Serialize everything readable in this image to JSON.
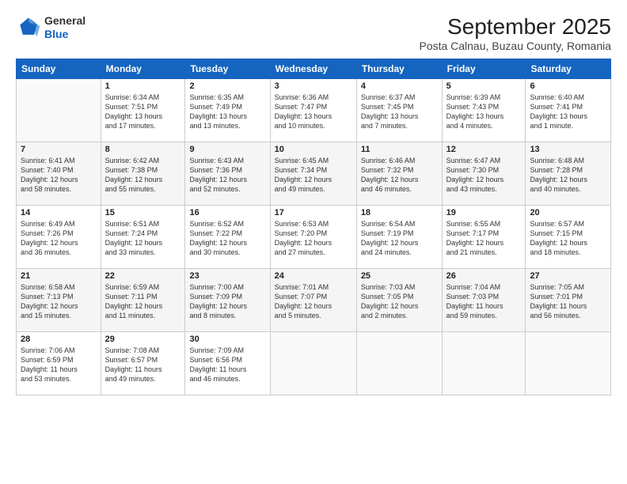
{
  "logo": {
    "general": "General",
    "blue": "Blue"
  },
  "header": {
    "month": "September 2025",
    "location": "Posta Calnau, Buzau County, Romania"
  },
  "weekdays": [
    "Sunday",
    "Monday",
    "Tuesday",
    "Wednesday",
    "Thursday",
    "Friday",
    "Saturday"
  ],
  "weeks": [
    [
      {
        "day": "",
        "info": ""
      },
      {
        "day": "1",
        "info": "Sunrise: 6:34 AM\nSunset: 7:51 PM\nDaylight: 13 hours\nand 17 minutes."
      },
      {
        "day": "2",
        "info": "Sunrise: 6:35 AM\nSunset: 7:49 PM\nDaylight: 13 hours\nand 13 minutes."
      },
      {
        "day": "3",
        "info": "Sunrise: 6:36 AM\nSunset: 7:47 PM\nDaylight: 13 hours\nand 10 minutes."
      },
      {
        "day": "4",
        "info": "Sunrise: 6:37 AM\nSunset: 7:45 PM\nDaylight: 13 hours\nand 7 minutes."
      },
      {
        "day": "5",
        "info": "Sunrise: 6:39 AM\nSunset: 7:43 PM\nDaylight: 13 hours\nand 4 minutes."
      },
      {
        "day": "6",
        "info": "Sunrise: 6:40 AM\nSunset: 7:41 PM\nDaylight: 13 hours\nand 1 minute."
      }
    ],
    [
      {
        "day": "7",
        "info": "Sunrise: 6:41 AM\nSunset: 7:40 PM\nDaylight: 12 hours\nand 58 minutes."
      },
      {
        "day": "8",
        "info": "Sunrise: 6:42 AM\nSunset: 7:38 PM\nDaylight: 12 hours\nand 55 minutes."
      },
      {
        "day": "9",
        "info": "Sunrise: 6:43 AM\nSunset: 7:36 PM\nDaylight: 12 hours\nand 52 minutes."
      },
      {
        "day": "10",
        "info": "Sunrise: 6:45 AM\nSunset: 7:34 PM\nDaylight: 12 hours\nand 49 minutes."
      },
      {
        "day": "11",
        "info": "Sunrise: 6:46 AM\nSunset: 7:32 PM\nDaylight: 12 hours\nand 46 minutes."
      },
      {
        "day": "12",
        "info": "Sunrise: 6:47 AM\nSunset: 7:30 PM\nDaylight: 12 hours\nand 43 minutes."
      },
      {
        "day": "13",
        "info": "Sunrise: 6:48 AM\nSunset: 7:28 PM\nDaylight: 12 hours\nand 40 minutes."
      }
    ],
    [
      {
        "day": "14",
        "info": "Sunrise: 6:49 AM\nSunset: 7:26 PM\nDaylight: 12 hours\nand 36 minutes."
      },
      {
        "day": "15",
        "info": "Sunrise: 6:51 AM\nSunset: 7:24 PM\nDaylight: 12 hours\nand 33 minutes."
      },
      {
        "day": "16",
        "info": "Sunrise: 6:52 AM\nSunset: 7:22 PM\nDaylight: 12 hours\nand 30 minutes."
      },
      {
        "day": "17",
        "info": "Sunrise: 6:53 AM\nSunset: 7:20 PM\nDaylight: 12 hours\nand 27 minutes."
      },
      {
        "day": "18",
        "info": "Sunrise: 6:54 AM\nSunset: 7:19 PM\nDaylight: 12 hours\nand 24 minutes."
      },
      {
        "day": "19",
        "info": "Sunrise: 6:55 AM\nSunset: 7:17 PM\nDaylight: 12 hours\nand 21 minutes."
      },
      {
        "day": "20",
        "info": "Sunrise: 6:57 AM\nSunset: 7:15 PM\nDaylight: 12 hours\nand 18 minutes."
      }
    ],
    [
      {
        "day": "21",
        "info": "Sunrise: 6:58 AM\nSunset: 7:13 PM\nDaylight: 12 hours\nand 15 minutes."
      },
      {
        "day": "22",
        "info": "Sunrise: 6:59 AM\nSunset: 7:11 PM\nDaylight: 12 hours\nand 11 minutes."
      },
      {
        "day": "23",
        "info": "Sunrise: 7:00 AM\nSunset: 7:09 PM\nDaylight: 12 hours\nand 8 minutes."
      },
      {
        "day": "24",
        "info": "Sunrise: 7:01 AM\nSunset: 7:07 PM\nDaylight: 12 hours\nand 5 minutes."
      },
      {
        "day": "25",
        "info": "Sunrise: 7:03 AM\nSunset: 7:05 PM\nDaylight: 12 hours\nand 2 minutes."
      },
      {
        "day": "26",
        "info": "Sunrise: 7:04 AM\nSunset: 7:03 PM\nDaylight: 11 hours\nand 59 minutes."
      },
      {
        "day": "27",
        "info": "Sunrise: 7:05 AM\nSunset: 7:01 PM\nDaylight: 11 hours\nand 56 minutes."
      }
    ],
    [
      {
        "day": "28",
        "info": "Sunrise: 7:06 AM\nSunset: 6:59 PM\nDaylight: 11 hours\nand 53 minutes."
      },
      {
        "day": "29",
        "info": "Sunrise: 7:08 AM\nSunset: 6:57 PM\nDaylight: 11 hours\nand 49 minutes."
      },
      {
        "day": "30",
        "info": "Sunrise: 7:09 AM\nSunset: 6:56 PM\nDaylight: 11 hours\nand 46 minutes."
      },
      {
        "day": "",
        "info": ""
      },
      {
        "day": "",
        "info": ""
      },
      {
        "day": "",
        "info": ""
      },
      {
        "day": "",
        "info": ""
      }
    ]
  ]
}
